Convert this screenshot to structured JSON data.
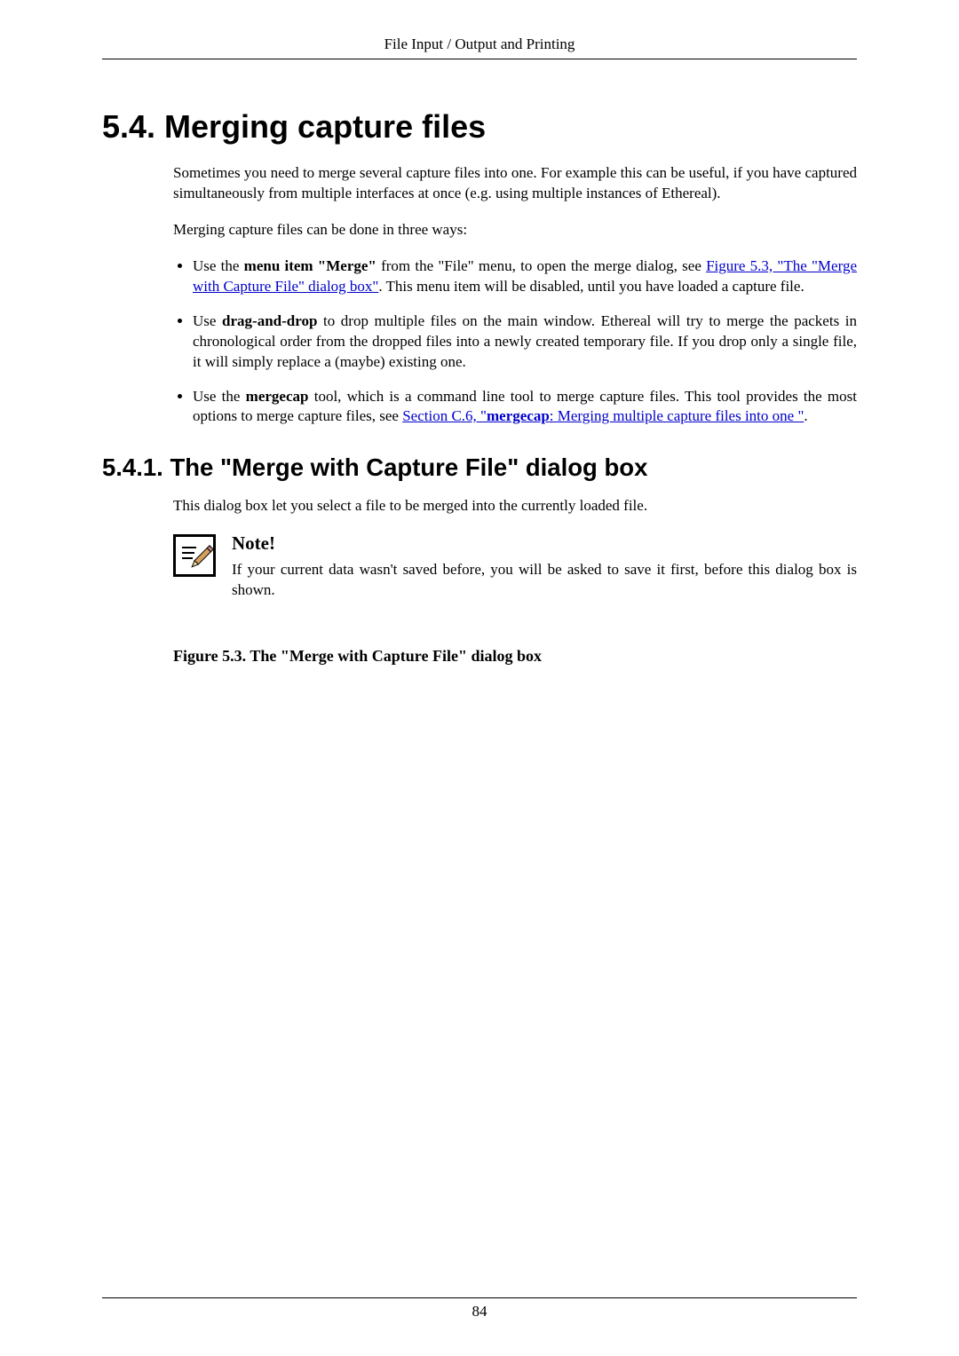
{
  "header": "File Input / Output and Printing",
  "section_title": "5.4. Merging capture files",
  "intro_para": "Sometimes you need to merge several capture files into one. For example this can be useful, if you have captured simultaneously from multiple interfaces at once (e.g. using multiple instances of Ethereal).",
  "ways_para": "Merging capture files can be done in three ways:",
  "bullets": {
    "b1": {
      "pre": "Use the ",
      "strong": "menu item \"Merge\"",
      "mid": " from the \"File\" menu, to open the merge dialog, see ",
      "link": "Figure 5.3, \"The \"Merge with Capture File\" dialog box\"",
      "post": ". This menu item will be disabled, until you have loaded a capture file."
    },
    "b2": {
      "pre": "Use ",
      "strong": "drag-and-drop",
      "post": " to drop multiple files on the main window. Ethereal will try to merge the packets in chronological order from the dropped files into a newly created temporary file. If you drop only a single file, it will simply replace a (maybe) existing one."
    },
    "b3": {
      "pre": "Use the ",
      "strong": "mergecap",
      "mid": " tool, which is a command line tool to merge capture files. This tool provides the most options to merge capture files, see ",
      "link_pre": "Section C.6, \"",
      "link_strong": "mergecap",
      "link_post": ": Merging multiple capture files into one \"",
      "post_link": "."
    }
  },
  "subsection_title": "5.4.1. The \"Merge with Capture File\" dialog box",
  "sub_para": "This dialog box let you select a file to be merged into the currently loaded file.",
  "note_title": "Note!",
  "note_body": "If your current data wasn't saved before, you will be asked to save it first, before this dialog box is shown.",
  "figure_caption": "Figure 5.3. The \"Merge with Capture File\" dialog box",
  "page_number": "84"
}
